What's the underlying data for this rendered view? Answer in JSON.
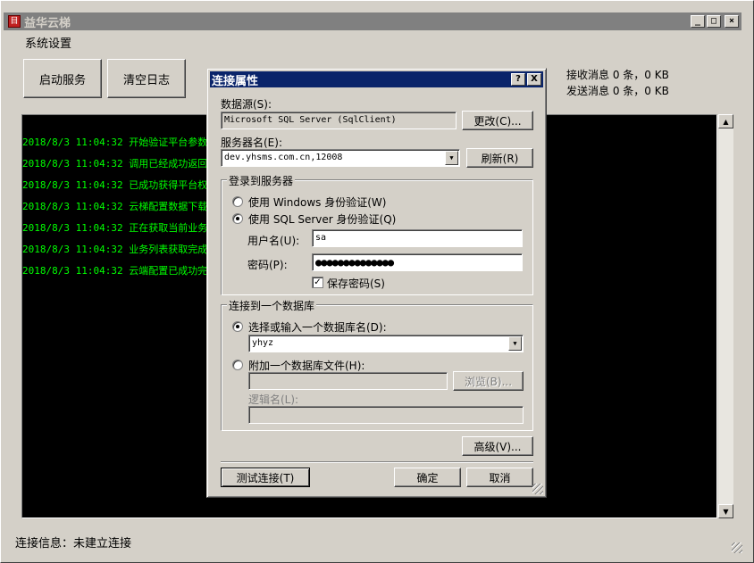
{
  "app": {
    "title": "益华云梯",
    "icon": "app-icon"
  },
  "menu": {
    "system_settings": "系统设置"
  },
  "buttons": {
    "start_service": "启动服务",
    "clear_log": "清空日志"
  },
  "stats": {
    "received": "接收消息 0 条，0 KB",
    "sent": "发送消息 0 条，0 KB"
  },
  "log": [
    "2018/8/3 11:04:32 开始验证平台参数…",
    "2018/8/3 11:04:32 调用已经成功返回…",
    "2018/8/3 11:04:32 已成功获得平台权限…",
    "2018/8/3 11:04:32 云梯配置数据下载完…",
    "2018/8/3 11:04:32 正在获取当前业务列…",
    "2018/8/3 11:04:32 业务列表获取完成…",
    "2018/8/3 11:04:32 云端配置已成功完成…"
  ],
  "status": {
    "connection": "连接信息：未建立连接"
  },
  "dialog": {
    "title": "连接属性",
    "help_btn": "?",
    "close_btn": "X",
    "datasource_label": "数据源(S):",
    "datasource_value": "Microsoft SQL Server (SqlClient)",
    "change_btn": "更改(C)...",
    "server_label": "服务器名(E):",
    "server_value": "dev.yhsms.com.cn,12008",
    "refresh_btn": "刷新(R)",
    "login_group": "登录到服务器",
    "windows_auth": "使用 Windows 身份验证(W)",
    "sql_auth": "使用 SQL Server 身份验证(Q)",
    "username_label": "用户名(U):",
    "username_value": "sa",
    "password_label": "密码(P):",
    "password_value": "●●●●●●●●●●●●●●",
    "save_password": "保存密码(S)",
    "db_group": "连接到一个数据库",
    "select_db": "选择或输入一个数据库名(D):",
    "db_value": "yhyz",
    "attach_db": "附加一个数据库文件(H):",
    "browse_btn": "浏览(B)...",
    "logical_name": "逻辑名(L):",
    "advanced_btn": "高级(V)...",
    "test_btn": "测试连接(T)",
    "ok_btn": "确定",
    "cancel_btn": "取消"
  }
}
